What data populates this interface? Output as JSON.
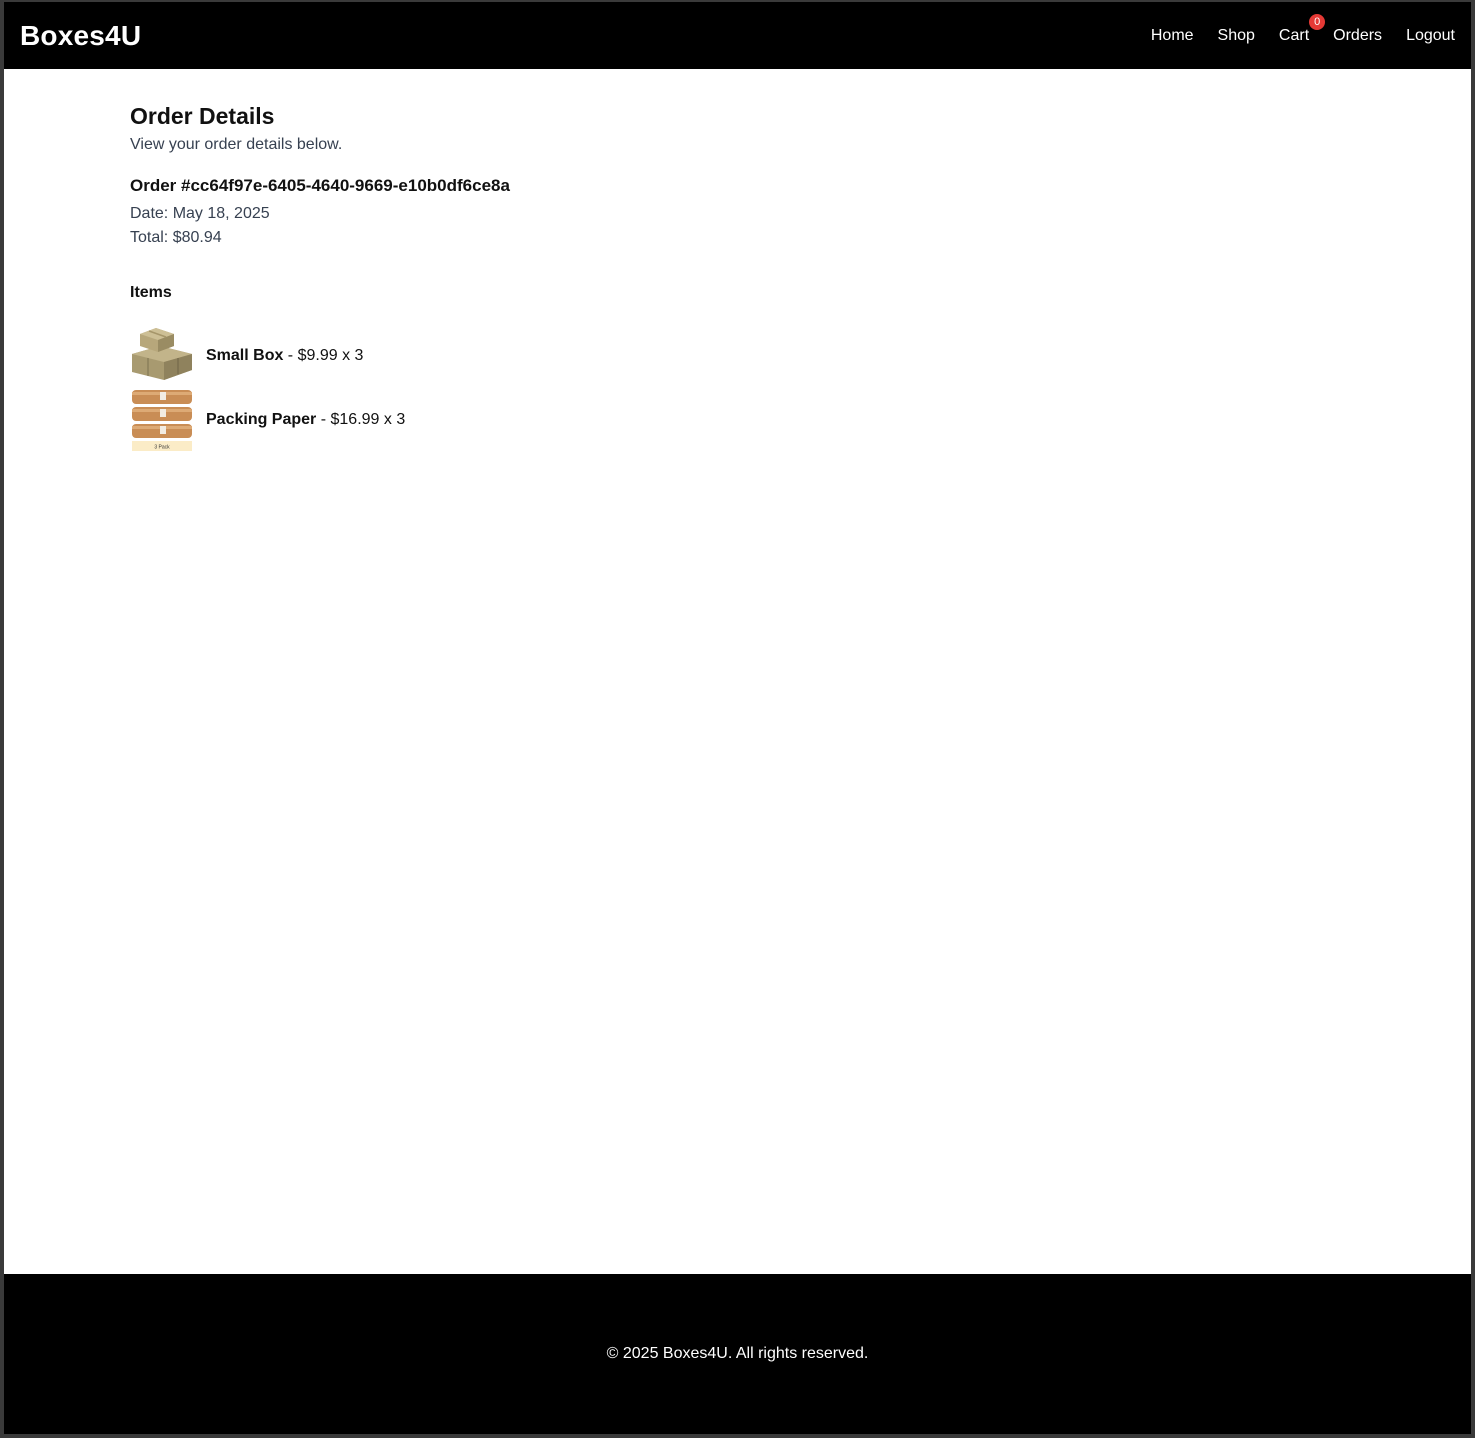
{
  "header": {
    "brand": "Boxes4U",
    "nav": {
      "home": "Home",
      "shop": "Shop",
      "cart": "Cart",
      "cart_count": "0",
      "orders": "Orders",
      "logout": "Logout"
    }
  },
  "page": {
    "title": "Order Details",
    "subtitle": "View your order details below."
  },
  "order": {
    "number": "Order #cc64f97e-6405-4640-9669-e10b0df6ce8a",
    "date": "Date: May 18, 2025",
    "total": "Total: $80.94"
  },
  "items_section": {
    "heading": "Items",
    "items": [
      {
        "name": "Small Box",
        "detail": " - $9.99 x 3",
        "icon": "cardboard-boxes-image"
      },
      {
        "name": "Packing Paper",
        "detail": " - $16.99 x 3",
        "icon": "packing-paper-rolls-image",
        "image_caption": "3 Pack"
      }
    ]
  },
  "footer": {
    "text": "© 2025 Boxes4U. All rights reserved."
  },
  "colors": {
    "navbar_bg": "#000000",
    "footer_bg": "#000000",
    "badge": "#e53935",
    "muted_text": "#374151"
  }
}
